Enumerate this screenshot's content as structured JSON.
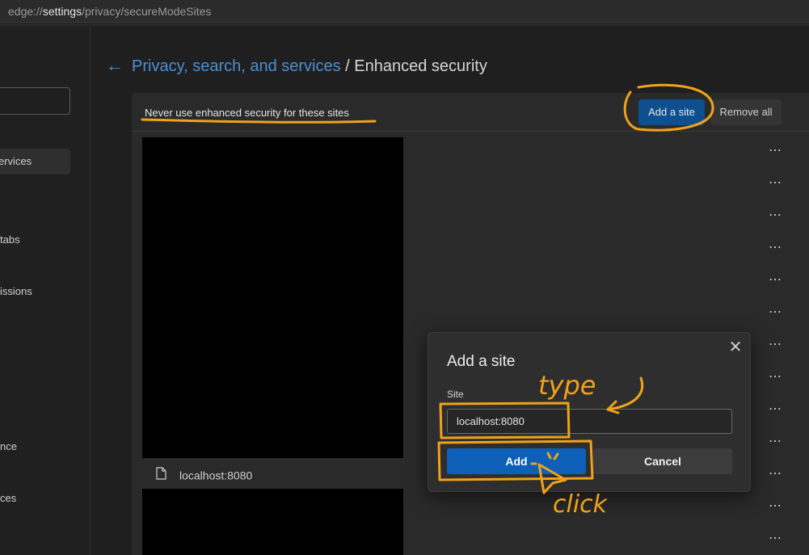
{
  "address_bar": {
    "prefix": "edge://",
    "bold": "settings",
    "suffix": "/privacy/secureModeSites"
  },
  "sidebar": {
    "items": [
      {
        "label": "ervices"
      },
      {
        "label": "tabs"
      },
      {
        "label": "issions"
      },
      {
        "label": "nce"
      },
      {
        "label": "ces"
      }
    ]
  },
  "breadcrumb": {
    "parent": "Privacy, search, and services",
    "separator": " / ",
    "current": "Enhanced security"
  },
  "panel": {
    "title": "Never use enhanced security for these sites",
    "add_button": "Add a site",
    "remove_all_button": "Remove all",
    "site_label": "localhost:8080"
  },
  "dialog": {
    "title": "Add a site",
    "field_label": "Site",
    "field_value": "localhost:8080",
    "add_button": "Add",
    "cancel_button": "Cancel"
  },
  "annotations": {
    "type_note": "type",
    "click_note": "click",
    "color": "#f0a21a"
  },
  "colors": {
    "accent": "#4c8fd6",
    "primary_button": "#0d5fb8",
    "annotation": "#f0a21a"
  }
}
